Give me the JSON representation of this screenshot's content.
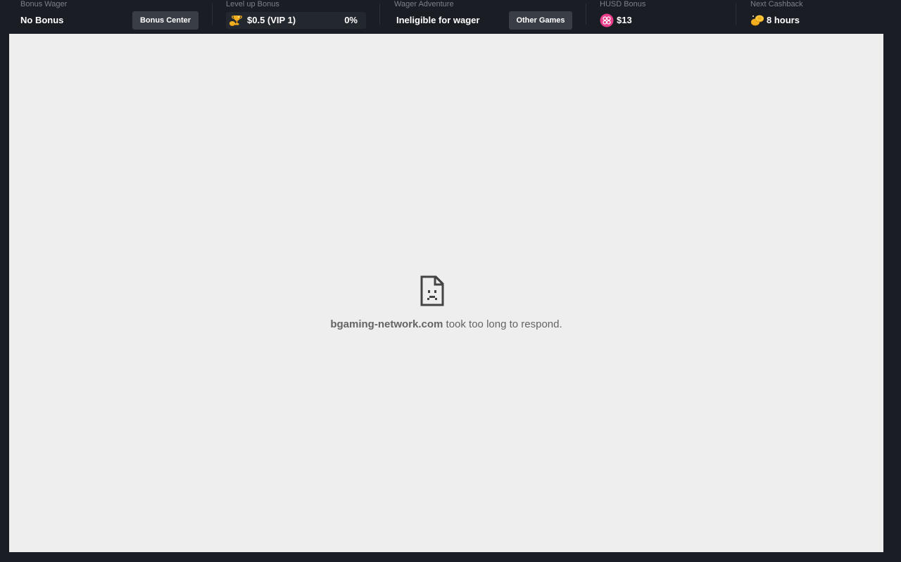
{
  "topbar": {
    "bonus_wager": {
      "label": "Bonus Wager",
      "value": "No Bonus",
      "button": "Bonus Center"
    },
    "level_up": {
      "label": "Level up Bonus",
      "value": "$0.5 (VIP 1)",
      "progress_text": "0%",
      "progress": 0
    },
    "wager_adventure": {
      "label": "Wager Adventure",
      "value": "Ineligible for wager",
      "button": "Other Games"
    },
    "husd_bonus": {
      "label": "HUSD Bonus",
      "value": "$13"
    },
    "next_cashback": {
      "label": "Next Cashback",
      "value": "8 hours"
    }
  },
  "error": {
    "host": "bgaming-network.com",
    "message": " took too long to respond."
  },
  "colors": {
    "topbar_bg": "#1a1d23",
    "button_bg": "#393d45",
    "content_bg": "#eeeeee",
    "husd_pink": "#e83e8c",
    "gold": "#f2b01e"
  },
  "icons": [
    "trophy-coins-icon",
    "husd-coin-icon",
    "cashback-coins-icon",
    "sad-file-icon"
  ]
}
